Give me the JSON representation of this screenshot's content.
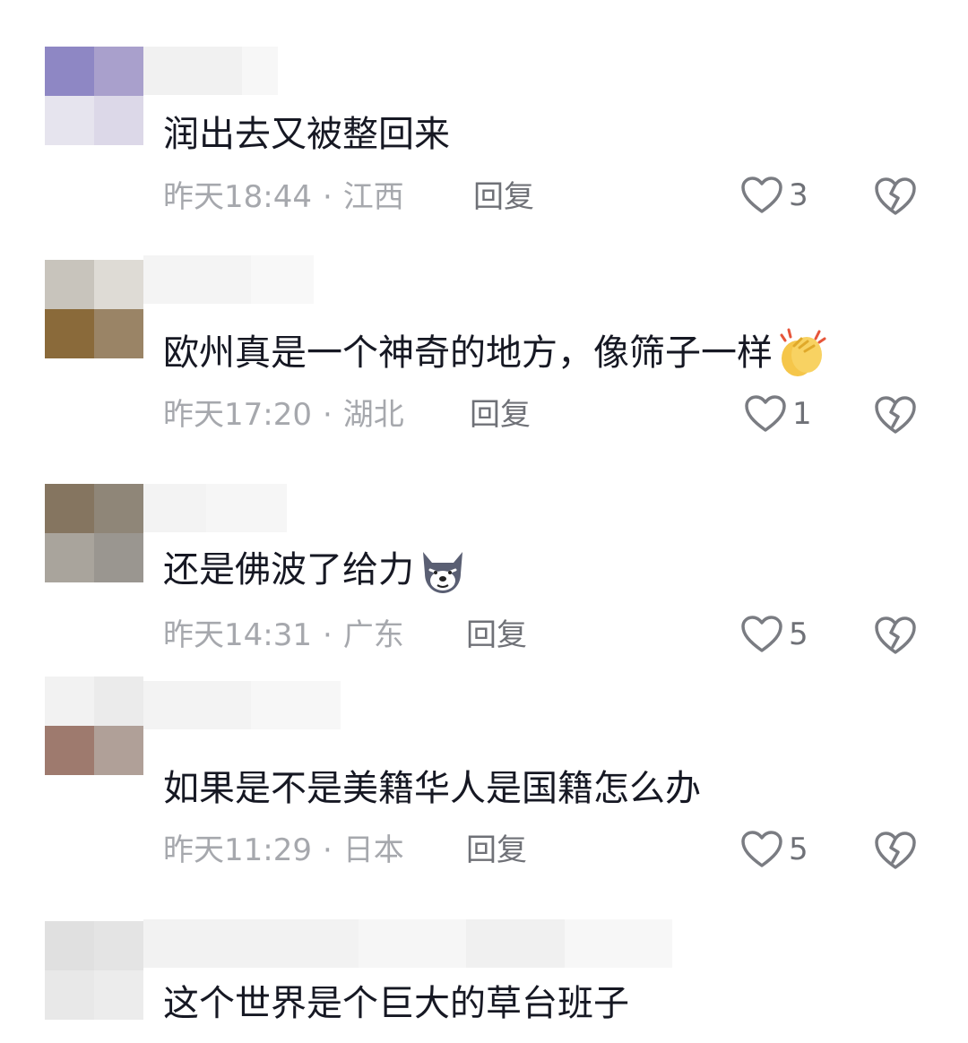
{
  "comments": [
    {
      "text": "润出去又被整回来",
      "time": "昨天18:44",
      "location": "江西",
      "reply_label": "回复",
      "likes": "3",
      "avatar_colors": [
        "#8e87c4",
        "#a9a0cc",
        "#e6e4ee",
        "#dcd8e8"
      ],
      "emoji": ""
    },
    {
      "text": "欧州真是一个神奇的地方，像筛子一样",
      "time": "昨天17:20",
      "location": "湖北",
      "reply_label": "回复",
      "likes": "1",
      "avatar_colors": [
        "#c8c4bc",
        "#dedbd5",
        "#8a6a3a",
        "#9a8466"
      ],
      "emoji": "clapping-hands-emoji"
    },
    {
      "text": "还是佛波了给力",
      "time": "昨天14:31",
      "location": "广东",
      "reply_label": "回复",
      "likes": "5",
      "avatar_colors": [
        "#857560",
        "#8f8678",
        "#a9a49c",
        "#9a9690"
      ],
      "emoji": "wolf-face-emoji"
    },
    {
      "text": "如果是不是美籍华人是国籍怎么办",
      "time": "昨天11:29",
      "location": "日本",
      "reply_label": "回复",
      "likes": "5",
      "avatar_colors": [
        "#f2f2f2",
        "#ebebeb",
        "#9e7a6e",
        "#b0a098"
      ],
      "emoji": ""
    },
    {
      "text": "这个世界是个巨大的草台班子",
      "time": "",
      "location": "",
      "reply_label": "",
      "likes": "",
      "avatar_colors": [
        "#e0e0e0",
        "#e4e4e4",
        "#e8e8e8",
        "#ececec"
      ],
      "emoji": ""
    }
  ],
  "colors": {
    "text": "#161823",
    "meta": "#a6a8ad",
    "action": "#6f7177",
    "icon_stroke": "#7a7c82"
  }
}
